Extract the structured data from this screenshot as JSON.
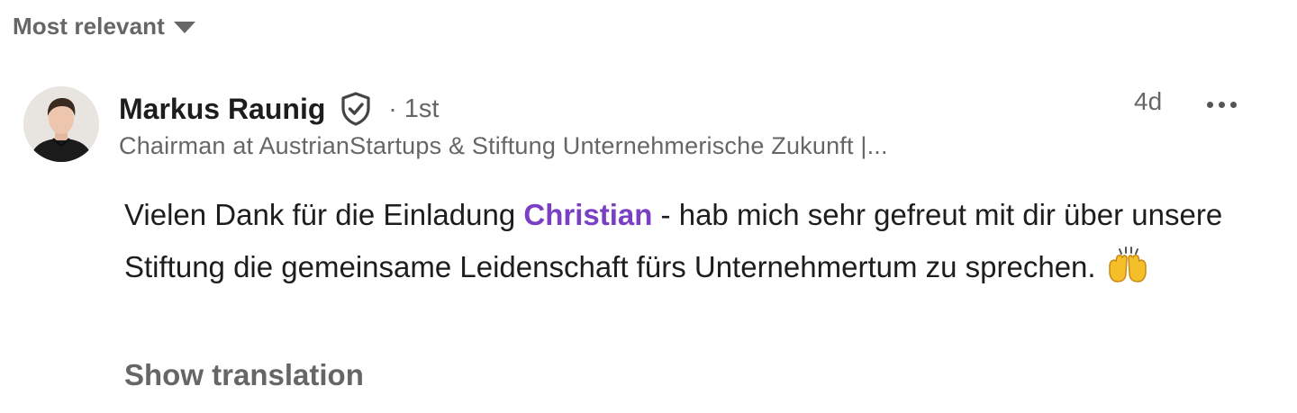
{
  "sort": {
    "label": "Most relevant",
    "icon": "caret-down-icon"
  },
  "comment": {
    "author": {
      "name": "Markus Raunig",
      "verified_icon": "verified-shield-icon",
      "degree_separator": "·",
      "degree": "1st",
      "headline": "Chairman at AustrianStartups & Stiftung Unternehmerische Zukunft |..."
    },
    "timestamp": "4d",
    "more_icon": "more-horizontal-icon",
    "text_before": "Vielen Dank für die Einladung ",
    "mention": "Christian",
    "text_after": " - hab mich sehr gefreut mit dir über unsere Stiftung die gemeinsame Leidenschaft fürs Unternehmertum zu sprechen.",
    "emoji_icon": "raising-hands-emoji",
    "show_translation": "Show translation"
  },
  "colors": {
    "text_primary": "#1d1d1d",
    "text_secondary": "#666666",
    "mention": "#7a3fc2",
    "emoji": "#f5bf2a"
  }
}
